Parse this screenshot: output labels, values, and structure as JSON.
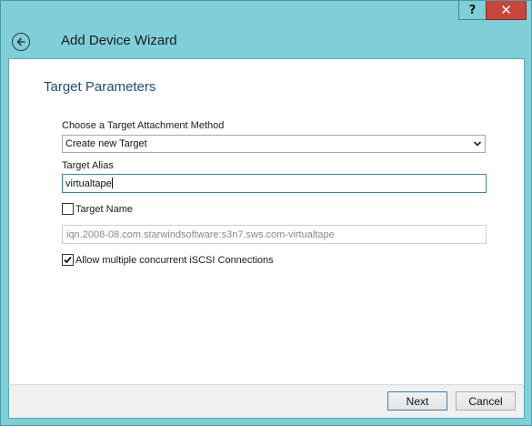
{
  "window": {
    "help_label": "?",
    "close_label": "✕"
  },
  "header": {
    "title": "Add Device Wizard",
    "back_icon": "back-arrow-icon"
  },
  "section": {
    "title": "Target Parameters"
  },
  "form": {
    "attachment_label": "Choose a Target Attachment Method",
    "attachment_value": "Create new Target",
    "alias_label": "Target Alias",
    "alias_value": "virtualtape",
    "target_name_label": "Target Name",
    "target_name_checked": false,
    "target_name_value": "iqn.2008-08.com.starwindsoftware:s3n7.sws.com-virtualtape",
    "multi_conn_label": "Allow multiple concurrent iSCSI Connections",
    "multi_conn_checked": true
  },
  "footer": {
    "next_label": "Next",
    "cancel_label": "Cancel"
  },
  "colors": {
    "chrome": "#7fcfd8",
    "close": "#c7463a",
    "section_title": "#1f4e79"
  }
}
